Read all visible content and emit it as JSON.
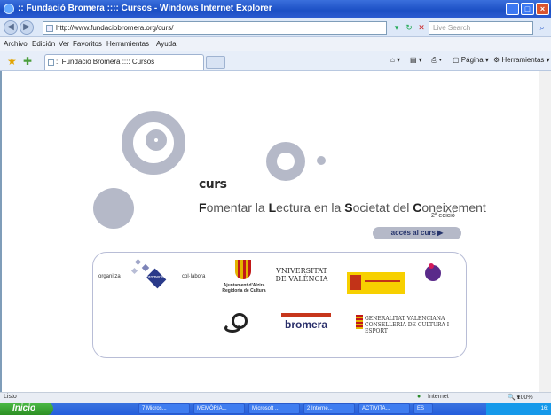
{
  "window": {
    "title": ":: Fundació Bromera :::: Cursos - Windows Internet Explorer"
  },
  "addressbar": {
    "url": "http://www.fundaciobromera.org/curs/",
    "search_placeholder": "Live Search"
  },
  "menu": [
    "Archivo",
    "Edición",
    "Ver",
    "Favoritos",
    "Herramientas",
    "Ayuda"
  ],
  "tab": {
    "label": ":: Fundació Bromera :::: Cursos"
  },
  "toolbar": {
    "page": "Página",
    "tools": "Herramientas"
  },
  "page": {
    "logo": "curs",
    "subtitle_parts": [
      {
        "text": "F",
        "bold": true
      },
      {
        "text": "omentar la ",
        "bold": false
      },
      {
        "text": "L",
        "bold": true
      },
      {
        "text": "ectura en la ",
        "bold": false
      },
      {
        "text": "S",
        "bold": true
      },
      {
        "text": "ocietat del ",
        "bold": false
      },
      {
        "text": "C",
        "bold": true
      },
      {
        "text": "oneixement",
        "bold": false
      }
    ],
    "edition": "2ª edició",
    "access_button": "accés al curs ▶",
    "organitza": "organitza",
    "collabora": "col·labora"
  },
  "sponsors": {
    "fundacio": "bromera",
    "alzira": "Ajuntament d'Alzira Regidoria de Cultura",
    "uv": "VNIVERSITAT DE VALÈNCIA",
    "bromera": "bromera",
    "gv": "GENERALITAT VALENCIANA CONSELLERIA DE CULTURA I ESPORT"
  },
  "statusbar": {
    "left": "Listo",
    "zone": "Internet",
    "zoom": "100%"
  },
  "taskbar": {
    "start": "Inicio",
    "buttons": [
      "7 Micros...",
      "MEMÒRIA...",
      "Microsoft ...",
      "2 Interne...",
      "ACTIVITA...",
      "ES"
    ],
    "clock": "16:"
  }
}
